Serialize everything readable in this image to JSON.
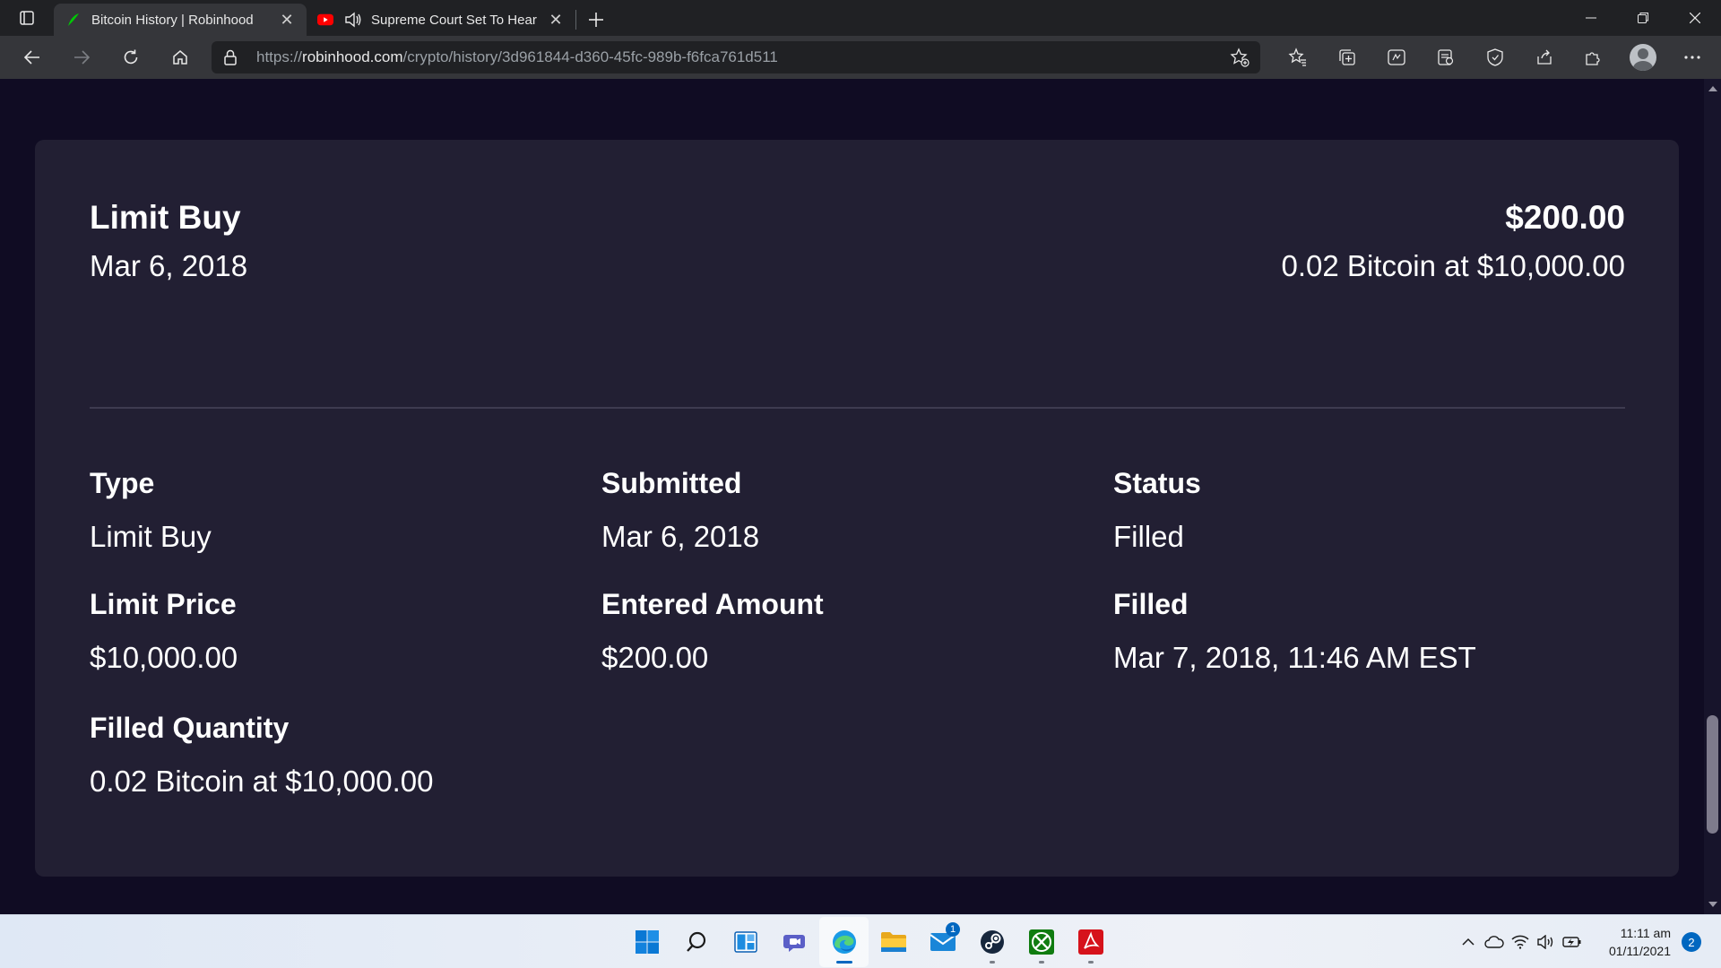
{
  "browser": {
    "tabs": [
      {
        "title": "Bitcoin History | Robinhood",
        "icon": "robinhood-feather-icon",
        "active": true
      },
      {
        "title": "Supreme Court Set To Hear",
        "icon": "youtube-icon",
        "active": false,
        "audio": true
      }
    ],
    "url": {
      "prefix": "https://",
      "domain": "robinhood.com",
      "path": "/crypto/history/3d961844-d360-45fc-989b-f6fca761d511"
    }
  },
  "order": {
    "title": "Limit Buy",
    "date": "Mar 6, 2018",
    "amount": "$200.00",
    "summary": "0.02 Bitcoin at $10,000.00",
    "fields": [
      {
        "label": "Type",
        "value": "Limit Buy"
      },
      {
        "label": "Submitted",
        "value": "Mar 6, 2018"
      },
      {
        "label": "Status",
        "value": "Filled"
      },
      {
        "label": "Limit Price",
        "value": "$10,000.00"
      },
      {
        "label": "Entered Amount",
        "value": "$200.00"
      },
      {
        "label": "Filled",
        "value": "Mar 7, 2018, 11:46 AM EST"
      },
      {
        "label": "Filled Quantity",
        "value": "0.02 Bitcoin at $10,000.00"
      }
    ]
  },
  "taskbar": {
    "mail_badge": "1",
    "time": "11:11 am",
    "date": "01/11/2021",
    "notifications": "2"
  },
  "colors": {
    "card": "#221f33",
    "page_bg": "#100c23",
    "accent": "#0067c0"
  }
}
